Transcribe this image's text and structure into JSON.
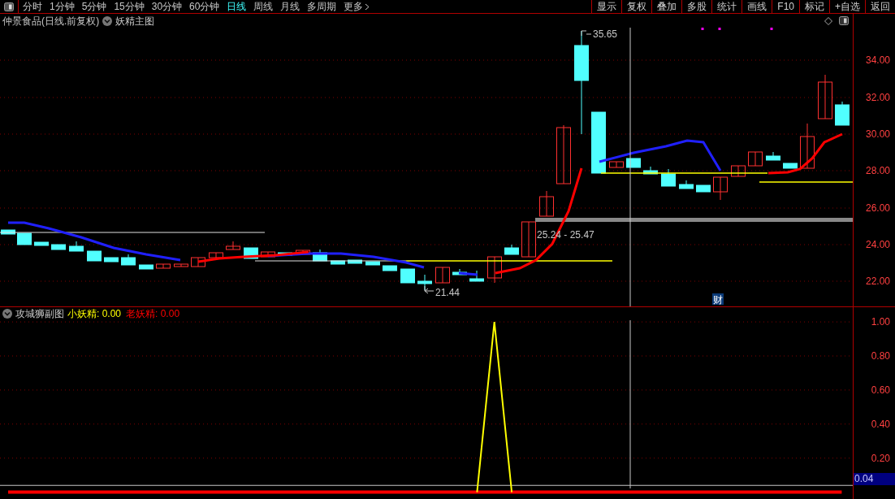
{
  "toolbar": {
    "periods": [
      {
        "label": "分时",
        "selected": false
      },
      {
        "label": "1分钟",
        "selected": false
      },
      {
        "label": "5分钟",
        "selected": false
      },
      {
        "label": "15分钟",
        "selected": false
      },
      {
        "label": "30分钟",
        "selected": false
      },
      {
        "label": "60分钟",
        "selected": false
      },
      {
        "label": "日线",
        "selected": true
      },
      {
        "label": "周线",
        "selected": false
      },
      {
        "label": "月线",
        "selected": false
      },
      {
        "label": "多周期",
        "selected": false
      },
      {
        "label": "更多",
        "selected": false
      }
    ],
    "buttons": [
      "显示",
      "复权",
      "叠加",
      "多股",
      "统计",
      "画线",
      "F10",
      "标记",
      "+自选",
      "返回"
    ]
  },
  "main_chart": {
    "title": "仲景食品(日线.前复权)",
    "indicator": "妖精主图",
    "y_labels": [
      "34.00",
      "32.00",
      "30.00",
      "28.00",
      "26.00",
      "24.00",
      "22.00"
    ],
    "high_label": "35.65",
    "low_label": "21.44",
    "range_label": "25.24 - 25.47",
    "badge": "财"
  },
  "sub_chart": {
    "indicator": "攻城狮副图",
    "legend": [
      {
        "value": ": 0.00"
      },
      {
        "value": ": 0.00"
      }
    ],
    "chart_data": {
      "type": "line",
      "ylim": [
        -0.04,
        1.01
      ],
      "grid": true,
      "ref_lines": [
        {
          "axis": "y",
          "value": 0.04,
          "label": "0.04"
        }
      ],
      "yticks": [
        {
          "value": 0.2,
          "label": "0.20"
        },
        {
          "value": 0.4,
          "label": "0.40"
        },
        {
          "value": 0.6,
          "label": "0.60"
        },
        {
          "value": 0.8,
          "label": "0.80"
        },
        {
          "value": 1.0,
          "label": "1.00"
        }
      ],
      "series": [
        {
          "name": "小妖精",
          "color": "#ffff00",
          "values": [
            null,
            null,
            null,
            null,
            null,
            null,
            null,
            null,
            null,
            null,
            null,
            null,
            null,
            null,
            null,
            null,
            null,
            null,
            null,
            null,
            null,
            null,
            null,
            null,
            null,
            null,
            null,
            0,
            1,
            0,
            null,
            null,
            null,
            null,
            null,
            null,
            null,
            null,
            null,
            null,
            null,
            null,
            null,
            null,
            null,
            null,
            null,
            null,
            null
          ]
        },
        {
          "name": "老妖精",
          "color": "#ff0000",
          "values": [
            0,
            0,
            0,
            0,
            0,
            0,
            0,
            0,
            0,
            0,
            0,
            0,
            0,
            0,
            0,
            0,
            0,
            0,
            0,
            0,
            0,
            0,
            0,
            0,
            0,
            0,
            0,
            0,
            0,
            0,
            0,
            0,
            0,
            0,
            0,
            0,
            0,
            0,
            0,
            0,
            0,
            0,
            0,
            0,
            0,
            0,
            0,
            0,
            0
          ]
        }
      ]
    }
  }
}
